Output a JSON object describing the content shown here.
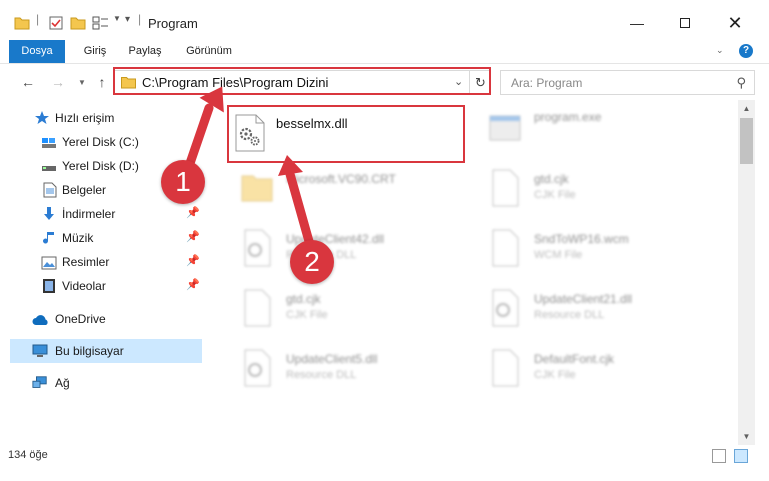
{
  "window": {
    "title": "Program",
    "minimize_icon": "minimize-icon",
    "maximize_icon": "maximize-icon",
    "close_icon": "close-icon"
  },
  "ribbon": {
    "tabs": [
      {
        "label": "Dosya"
      },
      {
        "label": "Giriş"
      },
      {
        "label": "Paylaş"
      },
      {
        "label": "Görünüm"
      }
    ],
    "help_label": "?"
  },
  "address": {
    "path": "C:\\Program Files\\Program Dizini",
    "search_placeholder": "Ara: Program"
  },
  "nav": {
    "items": [
      {
        "label": "Hızlı erişim",
        "icon": "star-icon"
      },
      {
        "label": "Yerel Disk (C:)",
        "icon": "drive-icon"
      },
      {
        "label": "Yerel Disk (D:)",
        "icon": "drive-icon"
      },
      {
        "label": "Belgeler",
        "icon": "document-icon"
      },
      {
        "label": "İndirmeler",
        "icon": "download-icon"
      },
      {
        "label": "Müzik",
        "icon": "music-icon"
      },
      {
        "label": "Resimler",
        "icon": "picture-icon"
      },
      {
        "label": "Videolar",
        "icon": "video-icon"
      },
      {
        "label": "OneDrive",
        "icon": "cloud-icon"
      },
      {
        "label": "Bu bilgisayar",
        "icon": "computer-icon"
      },
      {
        "label": "Ağ",
        "icon": "network-icon"
      }
    ]
  },
  "files": {
    "highlighted": {
      "name": "besselmx.dll"
    },
    "items": [
      {
        "name": "program.exe",
        "type": ""
      },
      {
        "name": "Microsoft.VC90.CRT",
        "type": ""
      },
      {
        "name": "gtd.cjk",
        "type": "CJK File"
      },
      {
        "name": "UpdateClient42.dll",
        "type": "Resource DLL"
      },
      {
        "name": "SndToWP16.wcm",
        "type": "WCM File"
      },
      {
        "name": "gtd.cjk",
        "type": "CJK File"
      },
      {
        "name": "UpdateClient21.dll",
        "type": "Resource DLL"
      },
      {
        "name": "UpdateClient5.dll",
        "type": "Resource DLL"
      },
      {
        "name": "DefaultFont.cjk",
        "type": "CJK File"
      }
    ]
  },
  "status": {
    "count": "134 öğe"
  },
  "annotations": {
    "badge1": "1",
    "badge2": "2",
    "color": "#d9363e"
  }
}
